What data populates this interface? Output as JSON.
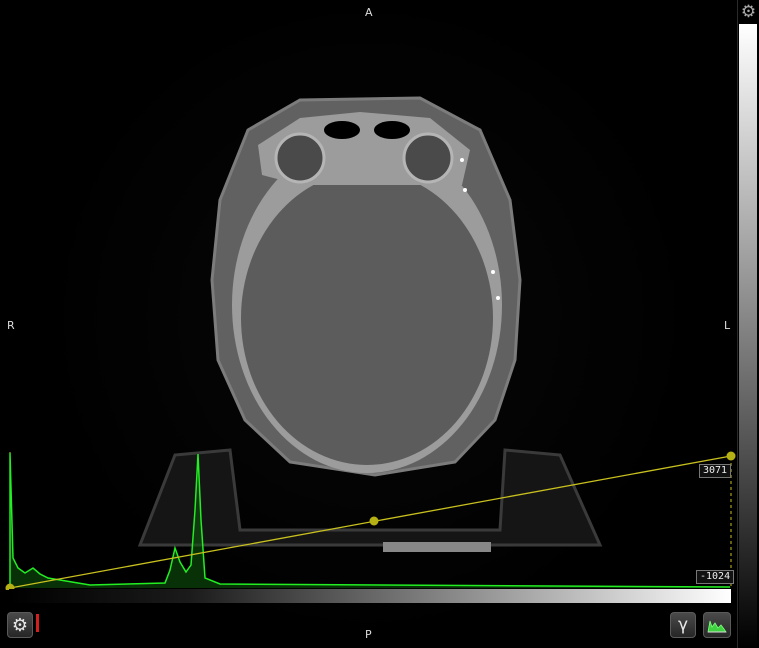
{
  "orientation": {
    "anterior": "A",
    "posterior": "P",
    "right": "R",
    "left": "L"
  },
  "transfer_function": {
    "max_value": "3071",
    "min_value": "-1024"
  },
  "toolbar": {
    "settings_icon": "gear-icon",
    "gamma_label": "γ",
    "histogram_icon": "histogram-icon",
    "colorbar_settings_icon": "gear-icon"
  },
  "colors": {
    "histogram": "#22ee22",
    "ramp_line": "#c8c01e",
    "control_point": "#b5b014"
  }
}
